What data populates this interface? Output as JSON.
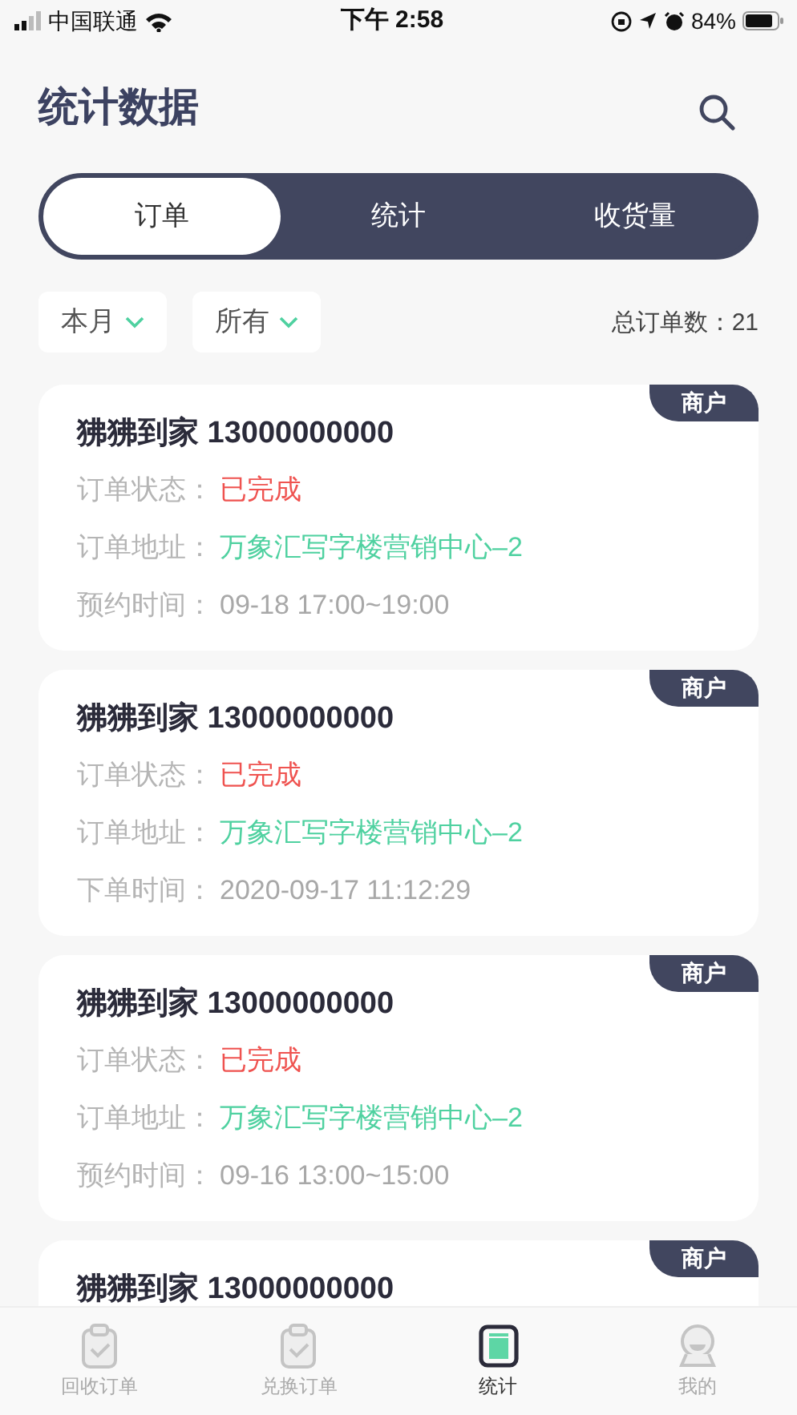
{
  "status_bar": {
    "carrier": "中国联通",
    "time": "下午 2:58",
    "battery": "84%"
  },
  "header": {
    "title": "统计数据"
  },
  "tabs": [
    {
      "label": "订单",
      "selected": true
    },
    {
      "label": "统计",
      "selected": false
    },
    {
      "label": "收货量",
      "selected": false
    }
  ],
  "filters": [
    {
      "label": "本月"
    },
    {
      "label": "所有"
    }
  ],
  "total": {
    "label": "总订单数：",
    "value": "21"
  },
  "orders": [
    {
      "tag": "商户",
      "title": "狒狒到家 13000000000",
      "fields": [
        {
          "kind": "status",
          "label": "订单状态：",
          "value": "已完成"
        },
        {
          "kind": "address",
          "label": "订单地址：",
          "value": "万象汇写字楼营销中心–2"
        },
        {
          "kind": "time",
          "label": "预约时间：",
          "value": "09-18 17:00~19:00"
        }
      ]
    },
    {
      "tag": "商户",
      "title": "狒狒到家 13000000000",
      "fields": [
        {
          "kind": "status",
          "label": "订单状态：",
          "value": "已完成"
        },
        {
          "kind": "address",
          "label": "订单地址：",
          "value": "万象汇写字楼营销中心–2"
        },
        {
          "kind": "time",
          "label": "下单时间：",
          "value": "2020-09-17 11:12:29"
        }
      ]
    },
    {
      "tag": "商户",
      "title": "狒狒到家 13000000000",
      "fields": [
        {
          "kind": "status",
          "label": "订单状态：",
          "value": "已完成"
        },
        {
          "kind": "address",
          "label": "订单地址：",
          "value": "万象汇写字楼营销中心–2"
        },
        {
          "kind": "time",
          "label": "预约时间：",
          "value": "09-16 13:00~15:00"
        }
      ]
    },
    {
      "tag": "商户",
      "title": "狒狒到家 13000000000"
    }
  ],
  "bottom_nav": [
    {
      "label": "回收订单",
      "kind": "clipboard",
      "selected": false
    },
    {
      "label": "兑换订单",
      "kind": "clipboard",
      "selected": false
    },
    {
      "label": "统计",
      "kind": "stats",
      "selected": true
    },
    {
      "label": "我的",
      "kind": "person",
      "selected": false
    }
  ]
}
